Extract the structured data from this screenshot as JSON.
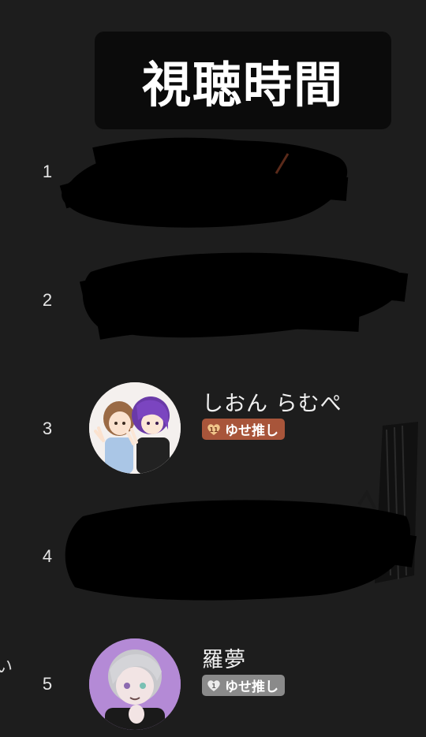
{
  "title": "視聴時間",
  "edge_char": "い",
  "ranking": [
    {
      "rank": "1",
      "name": "",
      "redacted": true
    },
    {
      "rank": "2",
      "name": "",
      "redacted": true
    },
    {
      "rank": "3",
      "name": "しおん らむぺ",
      "badge": "ゆせ推し",
      "badge_color": "#a8553a",
      "icon": "couple-avatar-icon"
    },
    {
      "rank": "4",
      "name": "",
      "redacted": true
    },
    {
      "rank": "5",
      "name": "羅夢",
      "badge": "ゆせ推し",
      "badge_color": "#8a8a8a",
      "icon": "silver-hair-avatar-icon"
    }
  ],
  "colors": {
    "background": "#1d1d1d",
    "title_box": "#0b0b0b",
    "badge_bronze": "#a8553a",
    "badge_gray": "#8a8a8a"
  }
}
